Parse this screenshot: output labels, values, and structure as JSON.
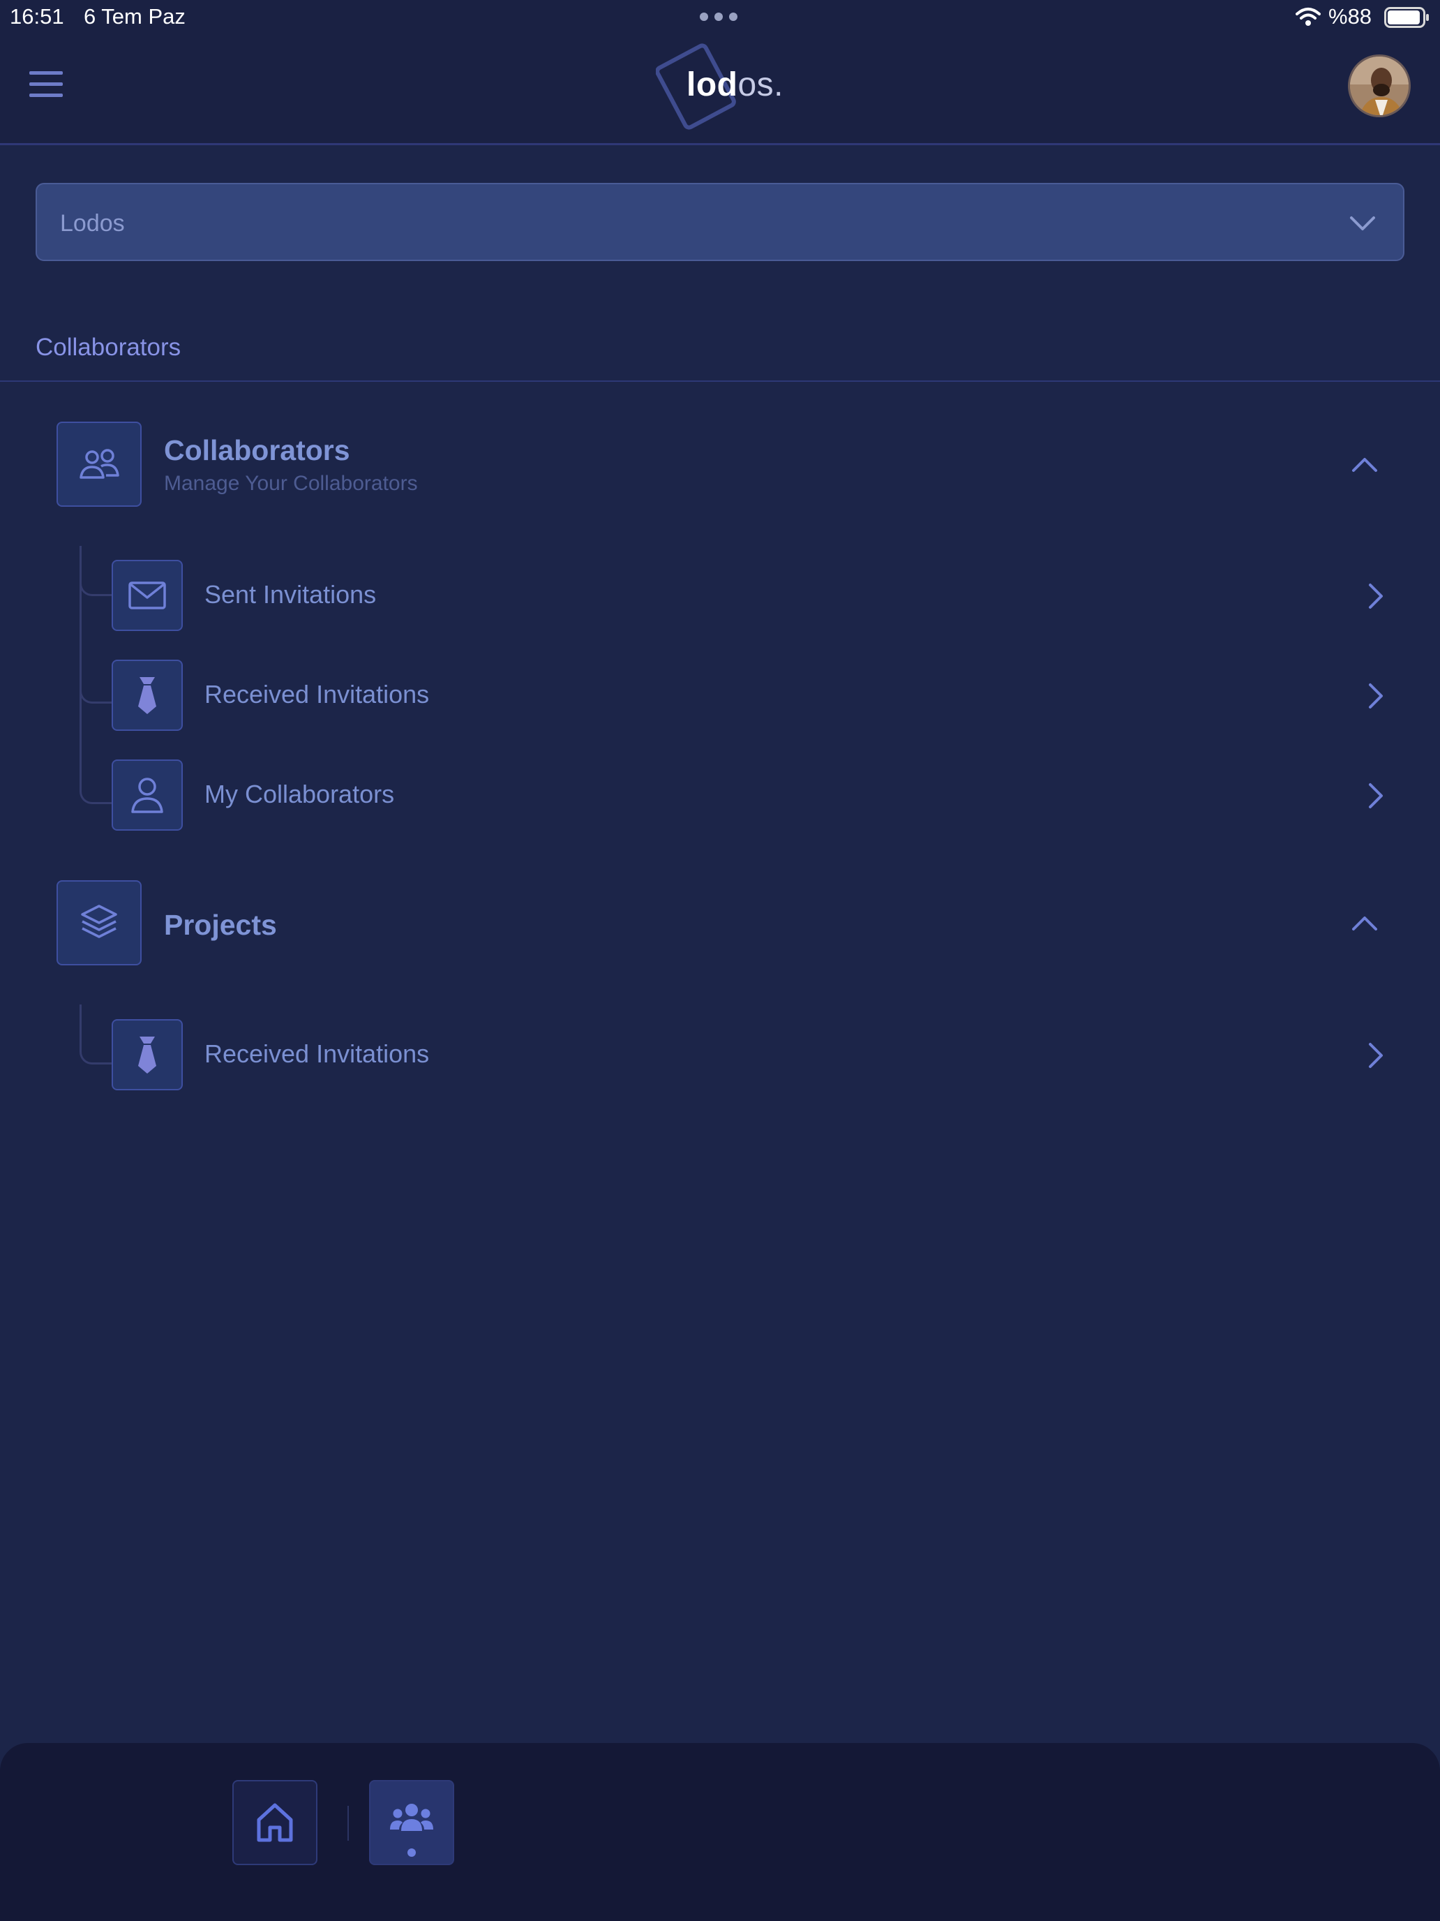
{
  "status_bar": {
    "time": "16:51",
    "date": "6 Tem Paz",
    "battery": "%88"
  },
  "header": {
    "logo_bold": "lod",
    "logo_light": "os."
  },
  "workspace_select": {
    "value": "Lodos"
  },
  "section": {
    "title": "Collaborators"
  },
  "groups": [
    {
      "title": "Collaborators",
      "subtitle": "Manage Your Collaborators",
      "icon": "users-icon",
      "items": [
        {
          "label": "Sent Invitations",
          "icon": "envelope-icon"
        },
        {
          "label": "Received Invitations",
          "icon": "tie-icon"
        },
        {
          "label": "My Collaborators",
          "icon": "user-icon"
        }
      ]
    },
    {
      "title": "Projects",
      "icon": "layers-icon",
      "items": [
        {
          "label": "Received Invitations",
          "icon": "tie-icon"
        }
      ]
    }
  ],
  "bottom_nav": {
    "items": [
      {
        "icon": "home-icon"
      },
      {
        "icon": "team-icon",
        "active": true
      }
    ]
  },
  "colors": {
    "background": "#1c2549",
    "header": "#1a2143",
    "accent": "#6c7fe0",
    "text": "#7b90d2"
  }
}
